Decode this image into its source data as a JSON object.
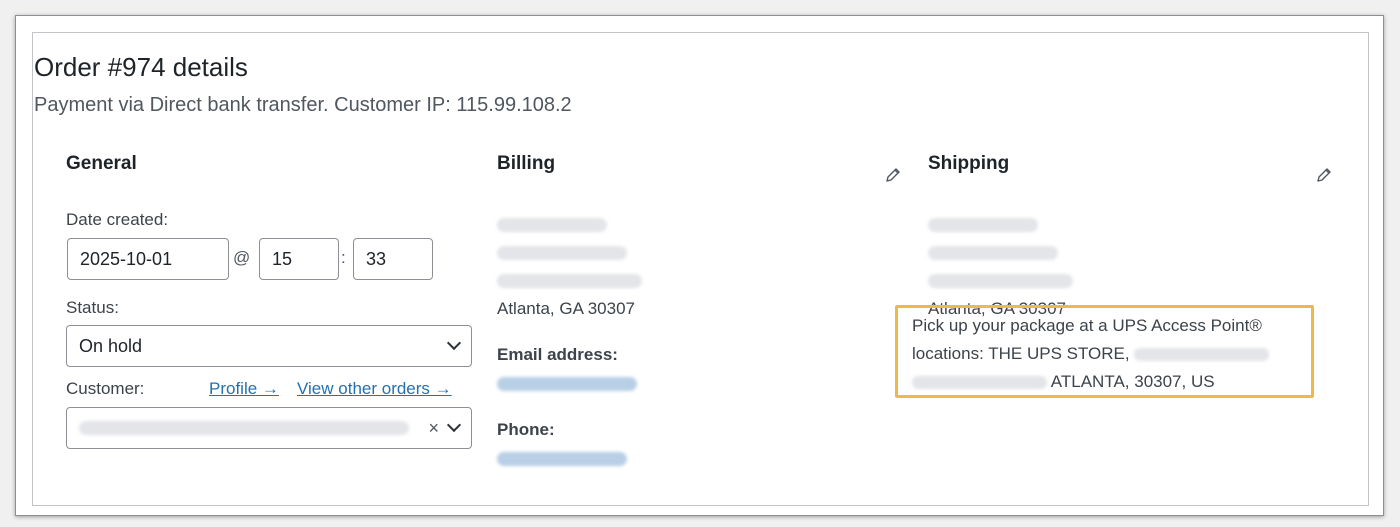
{
  "order": {
    "title": "Order #974 details",
    "subtitle": "Payment via Direct bank transfer. Customer IP: 115.99.108.2"
  },
  "general": {
    "heading": "General",
    "date_label": "Date created:",
    "date_value": "2025-10-01",
    "at_symbol": "@",
    "hour_value": "15",
    "time_separator": ":",
    "minute_value": "33",
    "status_label": "Status:",
    "status_value": "On hold",
    "customer_label": "Customer:",
    "profile_link": "Profile →",
    "view_orders_link": "View other orders →",
    "customer_clear": "×"
  },
  "billing": {
    "heading": "Billing",
    "city_line": "Atlanta, GA 30307",
    "email_label": "Email address:",
    "phone_label": "Phone:"
  },
  "shipping": {
    "heading": "Shipping",
    "city_line": "Atlanta, GA 30307",
    "notice_part1": "Pick up your package at a UPS Access Point® locations: THE UPS STORE,",
    "notice_part2": "ATLANTA, 30307, US",
    "highlight_color": "#f0b849"
  },
  "icons": {
    "edit": "pencil-icon",
    "dropdown": "chevron-down-icon",
    "clear": "close-icon"
  }
}
